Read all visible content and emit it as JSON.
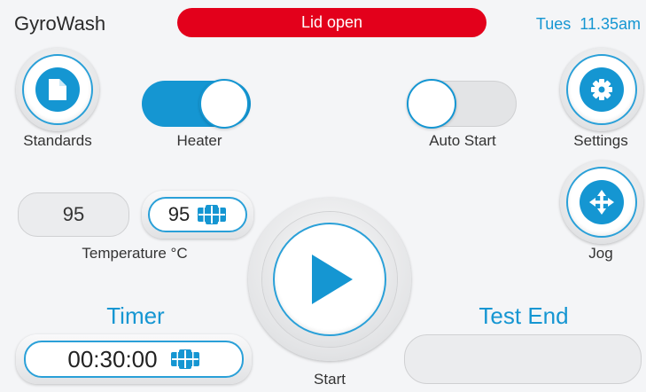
{
  "app": {
    "title": "GyroWash"
  },
  "status": {
    "message": "Lid open",
    "color": "#e3001b"
  },
  "clock": {
    "day": "Tues",
    "time": "11.35am"
  },
  "buttons": {
    "standards": "Standards",
    "settings": "Settings",
    "jog": "Jog",
    "start": "Start"
  },
  "toggles": {
    "heater": {
      "label": "Heater",
      "on": true
    },
    "auto_start": {
      "label": "Auto Start",
      "on": false
    }
  },
  "temperature": {
    "current": "95",
    "setpoint": "95",
    "label": "Temperature °C"
  },
  "timer": {
    "label": "Timer",
    "value": "00:30:00"
  },
  "test_end": {
    "label": "Test End",
    "value": ""
  },
  "colors": {
    "accent": "#1596d2",
    "alert": "#e3001b"
  },
  "icons": {
    "standards": "document-icon",
    "settings": "gear-icon",
    "jog": "move-arrows-icon",
    "start": "play-icon",
    "keypad": "keypad-icon"
  }
}
